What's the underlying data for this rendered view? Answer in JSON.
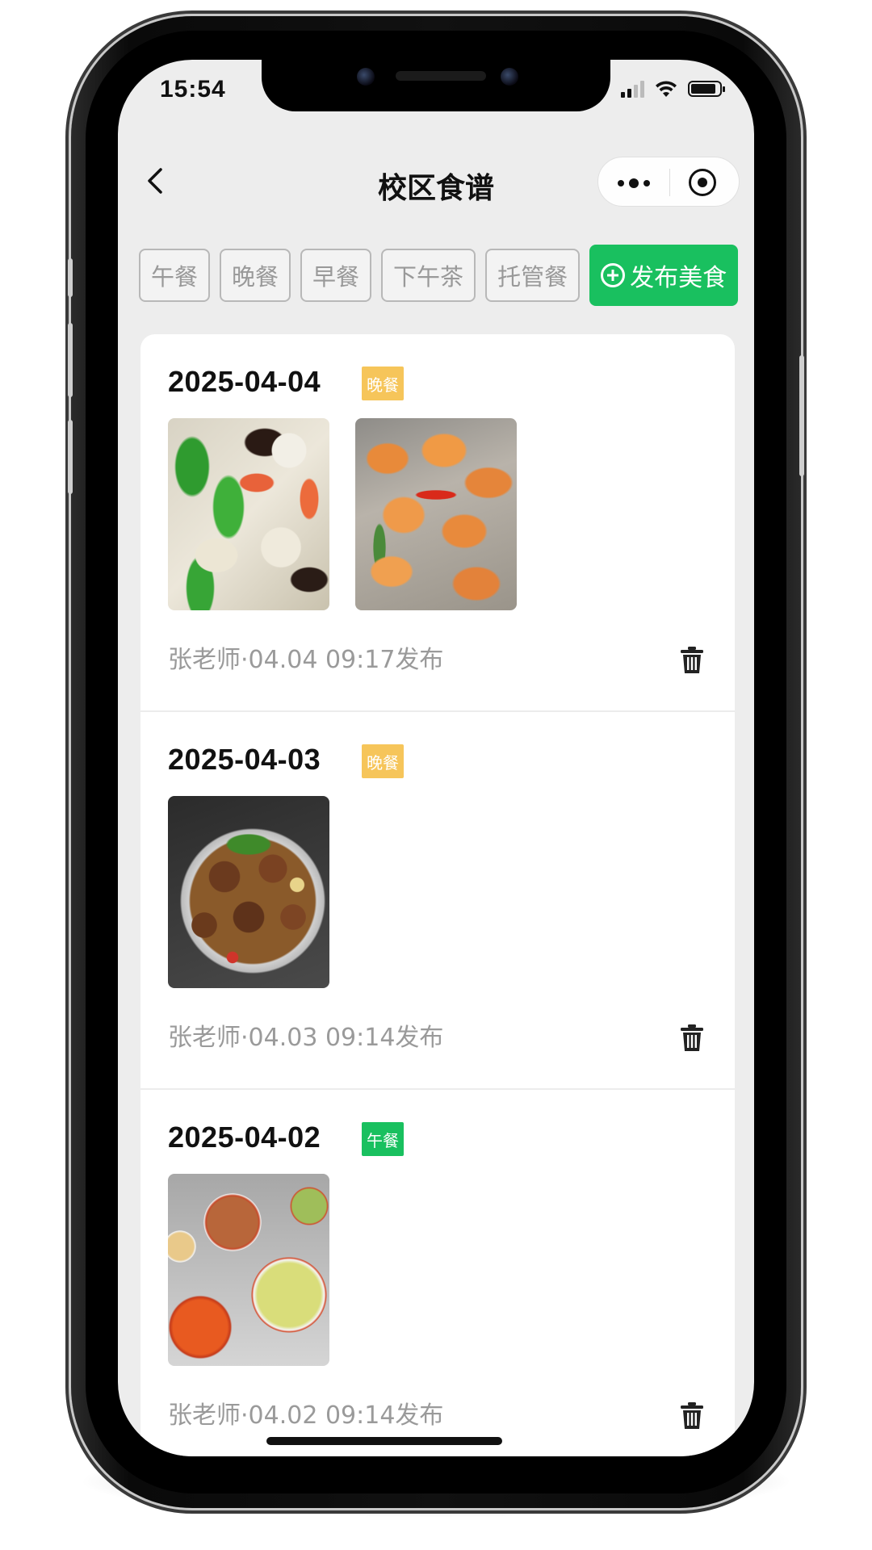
{
  "status": {
    "time": "15:54"
  },
  "nav": {
    "title": "校区食谱"
  },
  "filters": [
    "午餐",
    "晚餐",
    "早餐",
    "下午茶",
    "托管餐"
  ],
  "publish_label": "发布美食",
  "colors": {
    "accent": "#19c05f",
    "tag_dinner": "#f6c55a",
    "tag_lunch": "#19c05f"
  },
  "posts": [
    {
      "date": "2025-04-04",
      "tag": "晚餐",
      "meta": "张老师·04.04 09:17发布",
      "photos": [
        "stir-fried-vegetables-photo",
        "spicy-shrimp-photo"
      ]
    },
    {
      "date": "2025-04-03",
      "tag": "晚餐",
      "meta": "张老师·04.03 09:14发布",
      "photos": [
        "braised-meat-stew-photo"
      ]
    },
    {
      "date": "2025-04-02",
      "tag": "午餐",
      "meta": "张老师·04.02 09:14发布",
      "photos": [
        "canteen-buffet-photo"
      ]
    }
  ]
}
